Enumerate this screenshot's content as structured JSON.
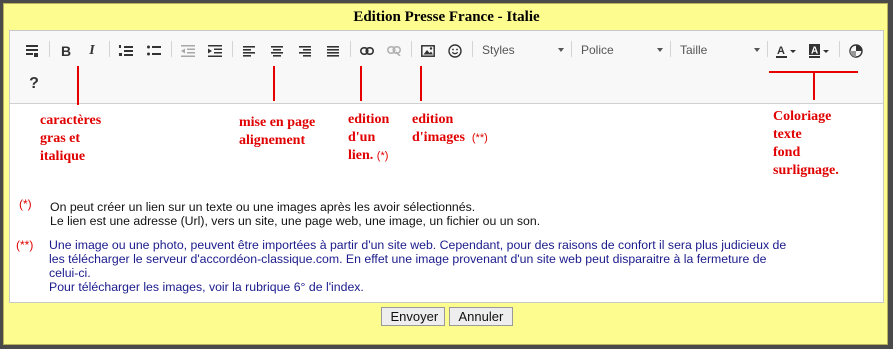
{
  "window": {
    "title": "Edition Presse France - Italie"
  },
  "toolbar": {
    "styles_label": "Styles",
    "police_label": "Police",
    "taille_label": "Taille",
    "help_label": "?"
  },
  "annotations": {
    "bold_italic": [
      "caractères",
      "gras et",
      "italique"
    ],
    "alignment": [
      "mise en page",
      "alignement"
    ],
    "link": [
      "edition",
      "d'un",
      "lien."
    ],
    "link_mark": "(*)",
    "images": [
      "edition",
      "d'images"
    ],
    "images_mark": "(**)",
    "color": [
      "Coloriage",
      "texte",
      "fond",
      "surlignage."
    ]
  },
  "notes": {
    "note1_mark": "(*)",
    "note1_lines": [
      "On peut créer un lien sur un texte ou une images après les avoir sélectionnés.",
      "Le lien est une adresse (Url), vers un site, une page web, une image, un fichier ou un son."
    ],
    "note2_mark": "(**)",
    "note2_lines": [
      "Une image ou une photo, peuvent être importées à partir d'un site web. Cependant, pour des raisons de confort il sera plus judicieux de",
      "les télécharger le serveur d'accordéon-classique.com. En effet une image provenant d'un site web peut disparaitre à la fermeture de",
      "celui-ci.",
      "Pour télécharger les images, voir la rubrique 6° de l'index."
    ]
  },
  "buttons": {
    "send": "Envoyer",
    "cancel": "Annuler"
  },
  "colors": {
    "background": "#fdfc8f",
    "annotation": "#e10000",
    "note2_text": "#1a1a8c"
  }
}
